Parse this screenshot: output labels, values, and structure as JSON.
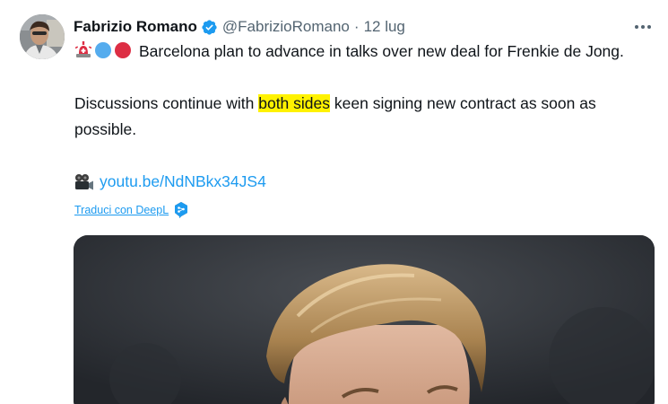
{
  "tweet": {
    "author_name": "Fabrizio Romano",
    "handle": "@FabrizioRomano",
    "separator": "·",
    "date": "12 lug",
    "text_line1_rest": "Barcelona plan to advance in talks over new deal for Frenkie de Jong.",
    "text_para2_before": "Discussions continue with ",
    "text_para2_highlight": "both sides",
    "text_para2_after": " keen signing new contract as soon as possible.",
    "link": "youtu.be/NdNBkx34JS4",
    "translate_label": "Traduci con DeepL"
  },
  "icons": {
    "verified": "verified-badge-icon",
    "more": "more-horizontal-icon",
    "siren": "police-light-emoji",
    "blue_circle": "blue-circle-emoji",
    "red_circle": "red-circle-emoji",
    "camera": "movie-camera-emoji",
    "deepl": "deepl-logo-icon"
  },
  "colors": {
    "link": "#1d9bf0",
    "secondary_text": "#536471",
    "highlight": "#fff200",
    "verified": "#1d9bf0"
  }
}
